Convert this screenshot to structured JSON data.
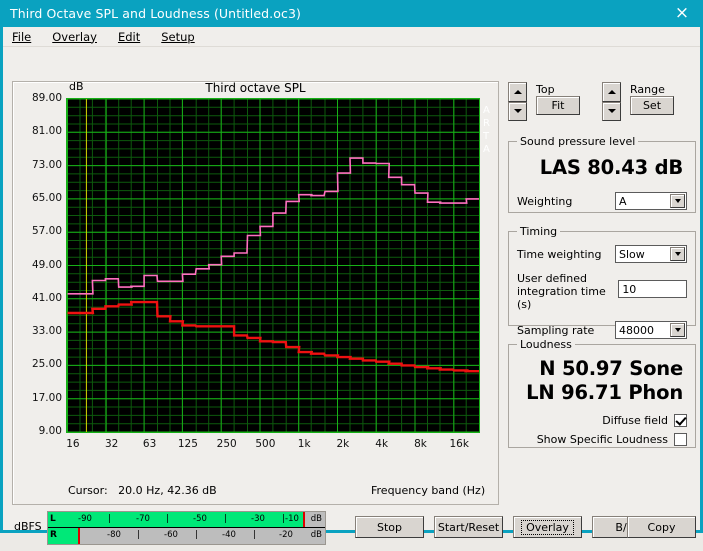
{
  "window": {
    "title": "Third Octave SPL and Loudness (Untitled.oc3)",
    "close_icon": "×",
    "titlebar_color": "#0aa2c0"
  },
  "menu": {
    "items": [
      {
        "label": "File"
      },
      {
        "label": "Overlay"
      },
      {
        "label": "Edit"
      },
      {
        "label": "Setup"
      }
    ]
  },
  "chart": {
    "title": "Third octave SPL",
    "y_unit": "dB",
    "x_axis_label": "Frequency band (Hz)",
    "watermark": "ARTA",
    "cursor_label": "Cursor:",
    "cursor_value": "20.0 Hz, 42.36 dB"
  },
  "chart_data": {
    "type": "line",
    "title": "Third octave SPL",
    "xlabel": "Frequency band (Hz)",
    "ylabel": "dB",
    "grid": true,
    "legend": "none",
    "x_scale": "log",
    "ylim": [
      9,
      89
    ],
    "ytick_labels": [
      "89.00",
      "81.00",
      "73.00",
      "65.00",
      "57.00",
      "49.00",
      "41.00",
      "33.00",
      "25.00",
      "17.00",
      "9.00"
    ],
    "ytick_values": [
      89,
      81,
      73,
      65,
      57,
      49,
      41,
      33,
      25,
      17,
      9
    ],
    "xtick_labels": [
      "16",
      "32",
      "63",
      "125",
      "250",
      "500",
      "1k",
      "2k",
      "4k",
      "8k",
      "16k"
    ],
    "xtick_values": [
      16,
      32,
      63,
      125,
      250,
      500,
      1000,
      2000,
      4000,
      8000,
      16000
    ],
    "categories": [
      16,
      20,
      25,
      31.5,
      40,
      50,
      63,
      80,
      100,
      125,
      160,
      200,
      250,
      315,
      400,
      500,
      630,
      800,
      1000,
      1250,
      1600,
      2000,
      2500,
      3150,
      4000,
      5000,
      6300,
      8000,
      10000,
      12500,
      16000,
      20000
    ],
    "series": [
      {
        "name": "SPL",
        "color": "#ff70c0",
        "values": [
          42.2,
          42.2,
          45.4,
          45.8,
          43.8,
          44.0,
          46.6,
          45.2,
          45.2,
          46.9,
          48.2,
          49.2,
          51.2,
          52.0,
          56.2,
          58.4,
          61.6,
          64.4,
          66.0,
          65.8,
          66.8,
          71.2,
          74.8,
          73.6,
          73.5,
          70.2,
          68.4,
          66.4,
          64.2,
          64.0,
          64.0,
          65.0
        ]
      },
      {
        "name": "Overlay",
        "color": "#ee1111",
        "values": [
          37.6,
          37.6,
          38.6,
          39.2,
          39.6,
          40.2,
          40.2,
          36.8,
          35.6,
          34.6,
          34.4,
          34.4,
          34.4,
          32.2,
          31.6,
          30.8,
          30.6,
          29.4,
          28.2,
          27.8,
          27.4,
          27.0,
          26.6,
          26.2,
          25.9,
          25.4,
          25.0,
          24.6,
          24.3,
          24.0,
          23.8,
          23.6
        ]
      }
    ],
    "cursor": {
      "frequency_hz": 20.0,
      "level_db": 42.36
    }
  },
  "chart_controls": {
    "top": {
      "label": "Top",
      "button": "Fit"
    },
    "range": {
      "label": "Range",
      "button": "Set"
    }
  },
  "spl_group": {
    "legend": "Sound pressure level",
    "reading": "LAS 80.43 dB",
    "weighting_label": "Weighting",
    "weighting_value": "A"
  },
  "timing_group": {
    "legend": "Timing",
    "time_weighting_label": "Time weighting",
    "time_weighting_value": "Slow",
    "integration_label_line1": "User defined",
    "integration_label_line2": "integration time (s)",
    "integration_value": "10",
    "sampling_rate_label": "Sampling rate",
    "sampling_rate_value": "48000"
  },
  "loudness_group": {
    "legend": "Loudness",
    "sone": "N 50.97 Sone",
    "phon": "LN 96.71 Phon",
    "diffuse_field_label": "Diffuse field",
    "diffuse_field_checked": true,
    "specific_loudness_label": "Show Specific Loudness",
    "specific_loudness_checked": false
  },
  "meter": {
    "label": "dBFS",
    "left_channel": "L",
    "right_channel": "R",
    "unit": "dB",
    "top_ticks": [
      "-90",
      "-70",
      "-50",
      "-30",
      "-10"
    ],
    "bottom_ticks": [
      "-80",
      "-60",
      "-40",
      "-20"
    ],
    "left_fill_pct": 92,
    "right_fill_pct": 11
  },
  "buttons": {
    "stop": "Stop",
    "start_reset": "Start/Reset",
    "overlay": "Overlay",
    "bw": "B/W",
    "copy": "Copy"
  }
}
